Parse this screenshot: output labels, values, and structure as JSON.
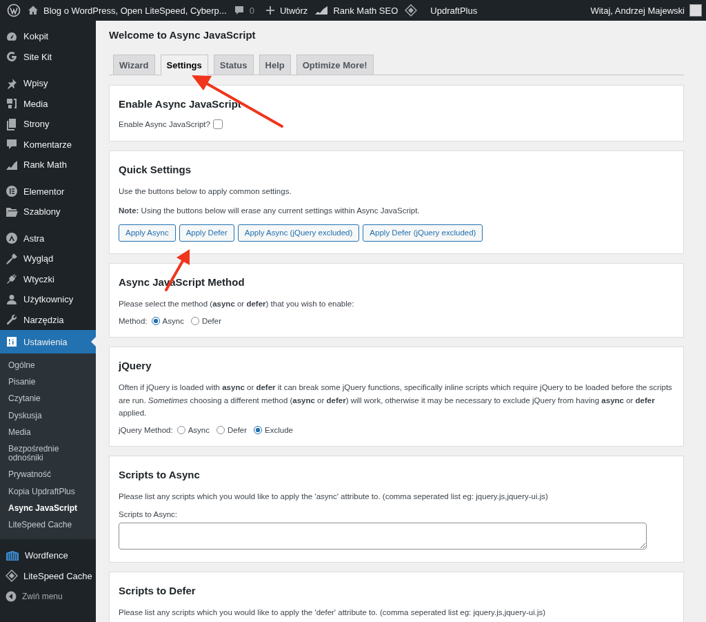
{
  "admin_bar": {
    "site_title": "Blog o WordPress, Open LiteSpeed, Cyberp...",
    "comments_count": "0",
    "new_label": "Utwórz",
    "seo_label": "Rank Math SEO",
    "backup_label": "UpdraftPlus",
    "greeting": "Witaj, Andrzej Majewski"
  },
  "sidebar": {
    "groups": [
      [
        {
          "label": "Kokpit",
          "selected": false
        },
        {
          "label": "Site Kit",
          "selected": false
        }
      ],
      [
        {
          "label": "Wpisy",
          "selected": false
        },
        {
          "label": "Media",
          "selected": false
        },
        {
          "label": "Strony",
          "selected": false
        },
        {
          "label": "Komentarze",
          "selected": false
        },
        {
          "label": "Rank Math",
          "selected": false
        }
      ],
      [
        {
          "label": "Elementor",
          "selected": false
        },
        {
          "label": "Szablony",
          "selected": false
        }
      ],
      [
        {
          "label": "Astra",
          "selected": false
        },
        {
          "label": "Wygląd",
          "selected": false
        },
        {
          "label": "Wtyczki",
          "selected": false
        },
        {
          "label": "Użytkownicy",
          "selected": false
        },
        {
          "label": "Narzędzia",
          "selected": false
        },
        {
          "label": "Ustawienia",
          "selected": true
        }
      ]
    ],
    "submenu": [
      {
        "label": "Ogólne",
        "selected": false
      },
      {
        "label": "Pisanie",
        "selected": false
      },
      {
        "label": "Czytanie",
        "selected": false
      },
      {
        "label": "Dyskusja",
        "selected": false
      },
      {
        "label": "Media",
        "selected": false
      },
      {
        "label": "Bezpośrednie odnośniki",
        "selected": false
      },
      {
        "label": "Prywatność",
        "selected": false
      },
      {
        "label": "Kopia UpdraftPlus",
        "selected": false
      },
      {
        "label": "Async JavaScript",
        "selected": true
      },
      {
        "label": "LiteSpeed Cache",
        "selected": false
      }
    ],
    "bottom_items": [
      {
        "label": "Wordfence"
      },
      {
        "label": "LiteSpeed Cache"
      }
    ],
    "collapse_label": "Zwiń menu"
  },
  "page_title": "Welcome to Async JavaScript",
  "tabs": [
    {
      "label": "Wizard",
      "selected": false
    },
    {
      "label": "Settings",
      "selected": true
    },
    {
      "label": "Status",
      "selected": false
    },
    {
      "label": "Help",
      "selected": false
    },
    {
      "label": "Optimize More!",
      "selected": false
    }
  ],
  "sections": [
    {
      "kind": "checkbox",
      "title": "Enable Async JavaScript",
      "label": "Enable Async JavaScript?",
      "checked": false
    },
    {
      "kind": "buttons",
      "title": "Quick Settings",
      "paragraphs": [
        "Use the buttons below to apply common settings.",
        "**Note:** Using the buttons below will erase any current settings within Async JavaScript."
      ],
      "buttons": [
        "Apply Async",
        "Apply Defer",
        "Apply Async (jQuery excluded)",
        "Apply Defer (jQuery excluded)"
      ]
    },
    {
      "kind": "radio",
      "title": "Async JavaScript Method",
      "paragraphs": [
        "Please select the method (**async** or **defer**) that you wish to enable:"
      ],
      "label": "Method:",
      "options": [
        {
          "label": "Async",
          "selected": true
        },
        {
          "label": "Defer",
          "selected": false
        }
      ]
    },
    {
      "kind": "radio",
      "title": "jQuery",
      "paragraphs": [
        "Often if jQuery is loaded with **async** or **defer** it can break some jQuery functions, specifically inline scripts which require jQuery to be loaded before the scripts are run. *Sometimes* choosing a different method (**async** or **defer**) will work, otherwise it may be necessary to exclude jQuery from having **async** or **defer** applied."
      ],
      "label": "jQuery Method:",
      "options": [
        {
          "label": "Async",
          "selected": false
        },
        {
          "label": "Defer",
          "selected": false
        },
        {
          "label": "Exclude",
          "selected": true
        }
      ]
    },
    {
      "kind": "textarea",
      "title": "Scripts to Async",
      "paragraphs": [
        "Please list any scripts which you would like to apply the 'async' attribute to. (comma seperated list eg: jquery.js,jquery-ui.js)"
      ],
      "label": "Scripts to Async:"
    },
    {
      "kind": "text",
      "title": "Scripts to Defer",
      "paragraphs": [
        "Please list any scripts which you would like to apply the 'defer' attribute to. (comma seperated list eg: jquery.js,jquery-ui.js)"
      ]
    }
  ]
}
